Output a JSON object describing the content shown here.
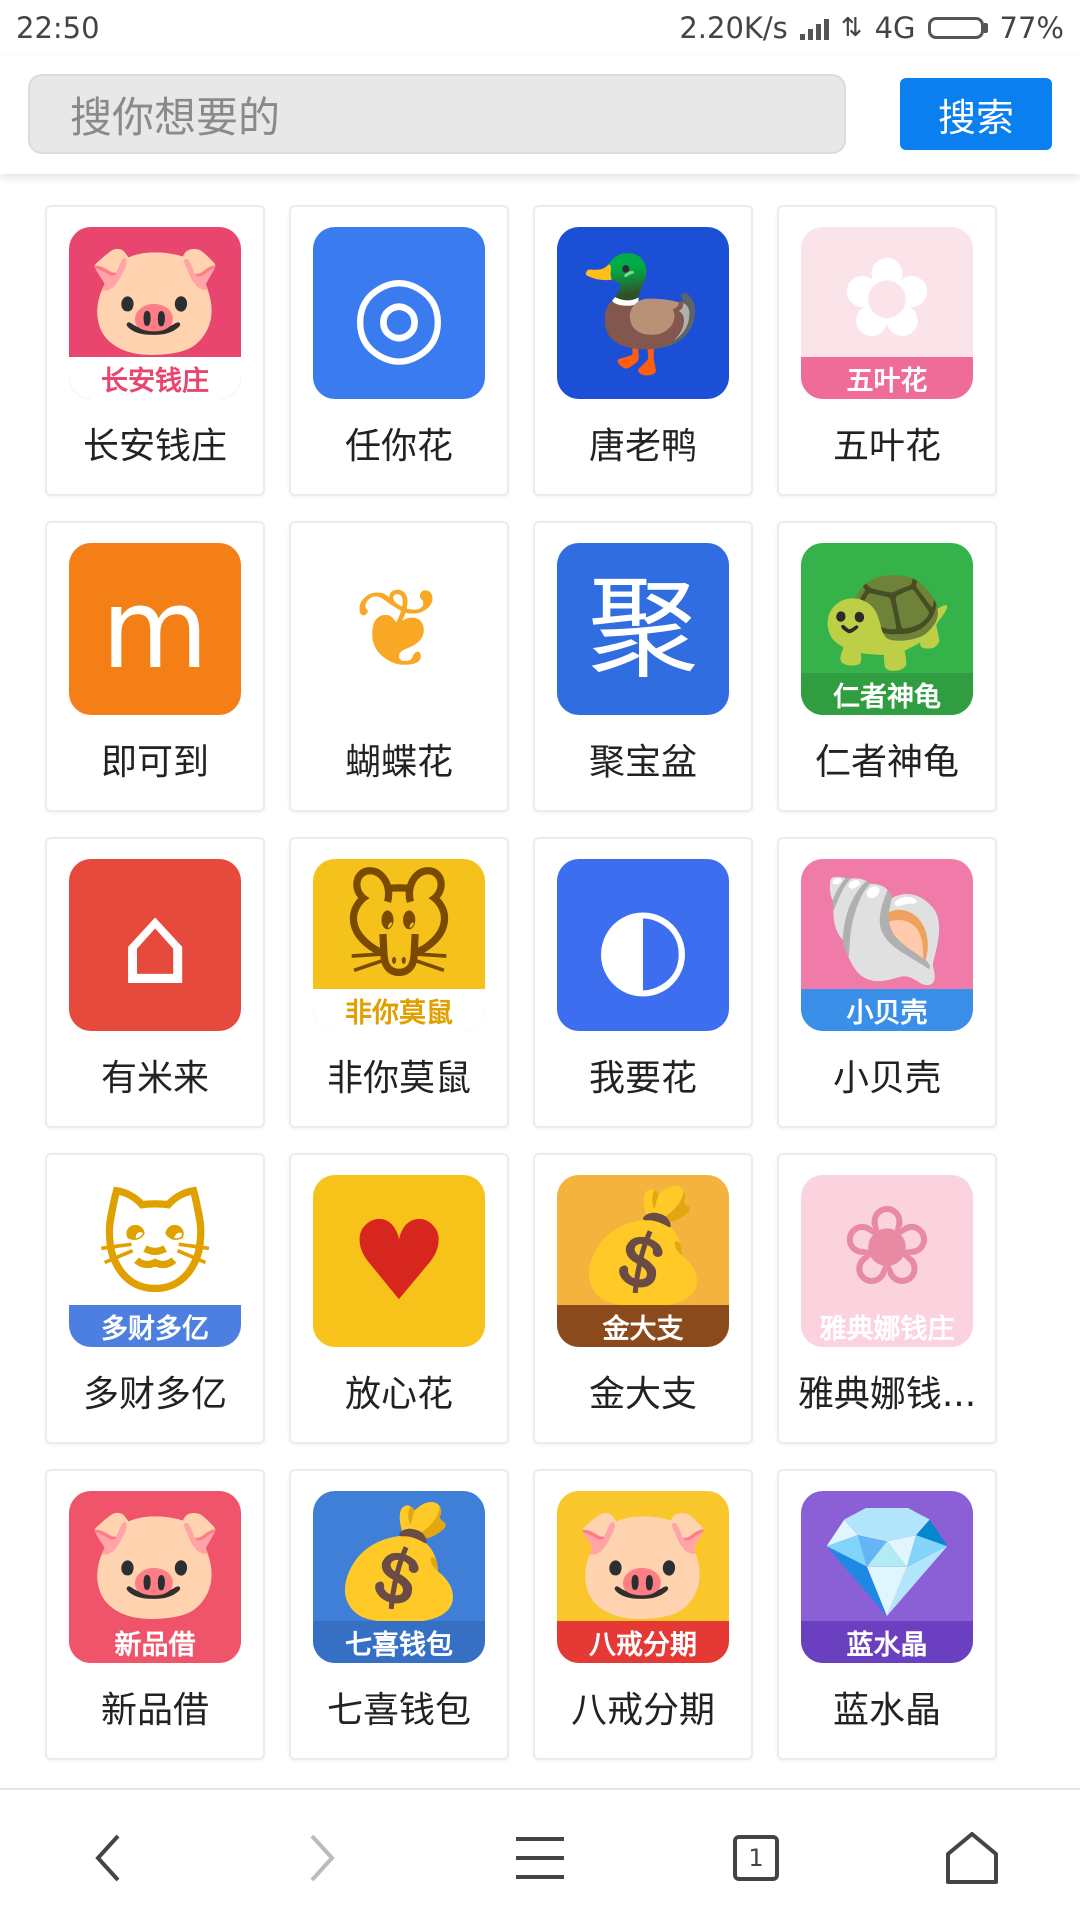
{
  "status_bar": {
    "time": "22:50",
    "speed": "2.20K/s",
    "network": "4G",
    "battery": "77%",
    "battery_level": 0.77
  },
  "search": {
    "placeholder": "搜你想要的",
    "button_label": "搜索"
  },
  "apps": [
    {
      "name": "长安钱庄",
      "icon": "gold-ingot-pig-icon",
      "bg": "#e8466f",
      "fg": "#f6c44d",
      "glyph": "🐷",
      "banner": "长安钱庄",
      "banner_bg": "#ffffff",
      "banner_fg": "#e8466f"
    },
    {
      "name": "任你花",
      "icon": "coin-circle-icon",
      "bg": "#3a7cf0",
      "fg": "#ffffff",
      "glyph": "◎",
      "banner": "",
      "banner_bg": "",
      "banner_fg": ""
    },
    {
      "name": "唐老鸭",
      "icon": "duck-icon",
      "bg": "#1a4fd6",
      "fg": "#ffffff",
      "glyph": "🦆",
      "banner": "",
      "banner_bg": "",
      "banner_fg": ""
    },
    {
      "name": "五叶花",
      "icon": "flower-icon",
      "bg": "#fbe3ea",
      "fg": "#ffffff",
      "glyph": "✿",
      "banner": "五叶花",
      "banner_bg": "#f06c98",
      "banner_fg": "#ffffff"
    },
    {
      "name": "即可到",
      "icon": "mk-logo-icon",
      "bg": "#f57f17",
      "fg": "#ffffff",
      "glyph": "m",
      "banner": "",
      "banner_bg": "",
      "banner_fg": ""
    },
    {
      "name": "蝴蝶花",
      "icon": "butterfly-icon",
      "bg": "#ffffff",
      "fg": "#f9a825",
      "glyph": "❦",
      "banner": "",
      "banner_bg": "",
      "banner_fg": ""
    },
    {
      "name": "聚宝盆",
      "icon": "ju-character-icon",
      "bg": "#2f6de0",
      "fg": "#ffffff",
      "glyph": "聚",
      "banner": "",
      "banner_bg": "",
      "banner_fg": ""
    },
    {
      "name": "仁者神龟",
      "icon": "turtle-icon",
      "bg": "#35b34a",
      "fg": "#ffffff",
      "glyph": "🐢",
      "banner": "仁者神龟",
      "banner_bg": "#2f9d40",
      "banner_fg": "#ffffff"
    },
    {
      "name": "有米来",
      "icon": "house-icon",
      "bg": "#e54a3d",
      "fg": "#ffffff",
      "glyph": "⌂",
      "banner": "",
      "banner_bg": "",
      "banner_fg": ""
    },
    {
      "name": "非你莫鼠",
      "icon": "mouse-icon",
      "bg": "#f5c21b",
      "fg": "#7a4a00",
      "glyph": "🐭",
      "banner": "非你莫鼠",
      "banner_bg": "#ffffff",
      "banner_fg": "#e0a100"
    },
    {
      "name": "我要花",
      "icon": "swirl-icon",
      "bg": "#3d6ef0",
      "fg": "#ffffff",
      "glyph": "◐",
      "banner": "",
      "banner_bg": "",
      "banner_fg": ""
    },
    {
      "name": "小贝壳",
      "icon": "shell-icon",
      "bg": "#f07aa8",
      "fg": "#3aa0f0",
      "glyph": "🐚",
      "banner": "小贝壳",
      "banner_bg": "#3a8fe8",
      "banner_fg": "#ffffff"
    },
    {
      "name": "多财多亿",
      "icon": "lucky-cat-icon",
      "bg": "#ffffff",
      "fg": "#e0a100",
      "glyph": "🐱",
      "banner": "多财多亿",
      "banner_bg": "#4d7fe0",
      "banner_fg": "#ffffff"
    },
    {
      "name": "放心花",
      "icon": "heart-yuan-icon",
      "bg": "#f7c21a",
      "fg": "#d7261e",
      "glyph": "♥",
      "banner": "",
      "banner_bg": "#b01e18",
      "banner_fg": "#ffffff"
    },
    {
      "name": "金大支",
      "icon": "treasure-chest-icon",
      "bg": "#f4b33c",
      "fg": "#7a3d12",
      "glyph": "💰",
      "banner": "金大支",
      "banner_bg": "#8a4a1c",
      "banner_fg": "#ffffff"
    },
    {
      "name": "雅典娜钱...",
      "icon": "athena-icon",
      "bg": "#fbd3de",
      "fg": "#e98aa4",
      "glyph": "❀",
      "banner": "雅典娜钱庄",
      "banner_bg": "#fbd3de",
      "banner_fg": "#ffffff"
    },
    {
      "name": "新品借",
      "icon": "rich-pig-icon",
      "bg": "#f0546a",
      "fg": "#f7c21a",
      "glyph": "🐷",
      "banner": "新品借",
      "banner_bg": "#f0546a",
      "banner_fg": "#ffffff"
    },
    {
      "name": "七喜钱包",
      "icon": "money-bag-icon",
      "bg": "#3f7fd8",
      "fg": "#e53935",
      "glyph": "💰",
      "banner": "七喜钱包",
      "banner_bg": "#3670c4",
      "banner_fg": "#ffffff"
    },
    {
      "name": "八戒分期",
      "icon": "pig-face-icon",
      "bg": "#f9c62b",
      "fg": "#f4a7b9",
      "glyph": "🐷",
      "banner": "八戒分期",
      "banner_bg": "#e53935",
      "banner_fg": "#ffffff"
    },
    {
      "name": "蓝水晶",
      "icon": "crystal-icon",
      "bg": "#8b5fd6",
      "fg": "#9fd3ff",
      "glyph": "💎",
      "banner": "蓝水晶",
      "banner_bg": "#6a3fc0",
      "banner_fg": "#ffffff"
    }
  ],
  "nav": {
    "tab_count": "1",
    "buttons": [
      "back-icon",
      "forward-icon",
      "menu-icon",
      "tabs-icon",
      "home-icon"
    ]
  }
}
